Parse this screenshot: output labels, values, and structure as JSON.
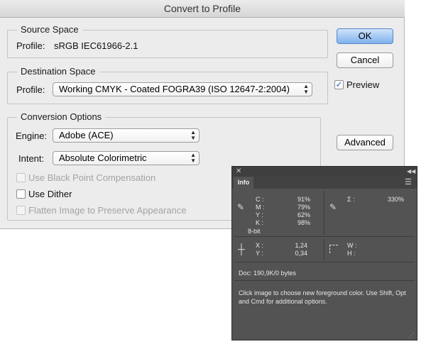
{
  "dialog": {
    "title": "Convert to Profile",
    "source_space": {
      "legend": "Source Space",
      "profile_label": "Profile:",
      "profile_value": "sRGB IEC61966-2.1"
    },
    "destination_space": {
      "legend": "Destination Space",
      "profile_label": "Profile:",
      "profile_value": "Working CMYK - Coated FOGRA39 (ISO 12647-2:2004)"
    },
    "conversion_options": {
      "legend": "Conversion Options",
      "engine_label": "Engine:",
      "engine_value": "Adobe (ACE)",
      "intent_label": "Intent:",
      "intent_value": "Absolute Colorimetric",
      "black_point": "Use Black Point Compensation",
      "dither": "Use Dither",
      "flatten": "Flatten Image to Preserve Appearance"
    },
    "buttons": {
      "ok": "OK",
      "cancel": "Cancel",
      "advanced": "Advanced"
    },
    "preview_label": "Preview"
  },
  "info_panel": {
    "tab": "Info",
    "cmyk": {
      "c_label": "C :",
      "c": "91%",
      "m_label": "M :",
      "m": "79%",
      "y_label": "Y :",
      "y": "62%",
      "k_label": "K :",
      "k": "98%",
      "bit": "8-bit"
    },
    "total": {
      "label": "Σ :",
      "value": "330%"
    },
    "coords": {
      "x_label": "X :",
      "x": "1,24",
      "y_label": "Y :",
      "y": "0,34"
    },
    "size": {
      "w_label": "W :",
      "h_label": "H :"
    },
    "doc": "Doc: 190,9K/0 bytes",
    "hint": "Click image to choose new foreground color.  Use Shift, Opt and Cmd for additional options."
  }
}
